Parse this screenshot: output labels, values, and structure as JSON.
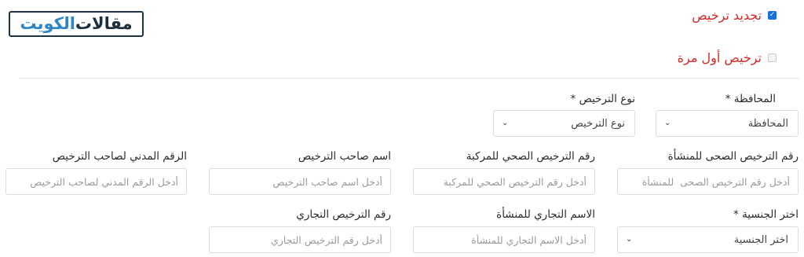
{
  "logo": {
    "part1": "مقالات",
    "part2": "الكويت"
  },
  "options": {
    "renew": {
      "label": "تجديد ترخيص",
      "checked": true
    },
    "first": {
      "label": "ترخيص أول مرة",
      "checked": false
    }
  },
  "form": {
    "governorate": {
      "label": "المحافظة *",
      "value": "المحافظة"
    },
    "license_type": {
      "label": "نوع الترخيص *",
      "value": "نوع الترخيص"
    },
    "health_license": {
      "label": "رقم الترخيص الصحى للمنشأة",
      "placeholder": "أدخل رقم الترخيص الصحى  للمنشأة"
    },
    "vehicle_license": {
      "label": "رقم الترخيص الصحي للمركبة",
      "placeholder": "أدخل رقم الترخيص الصحي للمركبة"
    },
    "owner_name": {
      "label": "اسم صاحب الترخيص",
      "placeholder": "أدخل اسم صاحب الترخيص"
    },
    "civil_id": {
      "label": "الرقم المدني لصاحب الترخيص",
      "placeholder": "أدخل الرقم المدني لصاحب الترخيص"
    },
    "nationality": {
      "label": "اختر الجنسية *",
      "value": "اختر الجنسية"
    },
    "trade_name": {
      "label": "الاسم التجاري للمنشأة",
      "placeholder": "أدخل الاسم التجاري للمنشأة"
    },
    "trade_license": {
      "label": "رقم الترخيص التجاري",
      "placeholder": "أدخل رقم الترخيص التجاري"
    }
  }
}
